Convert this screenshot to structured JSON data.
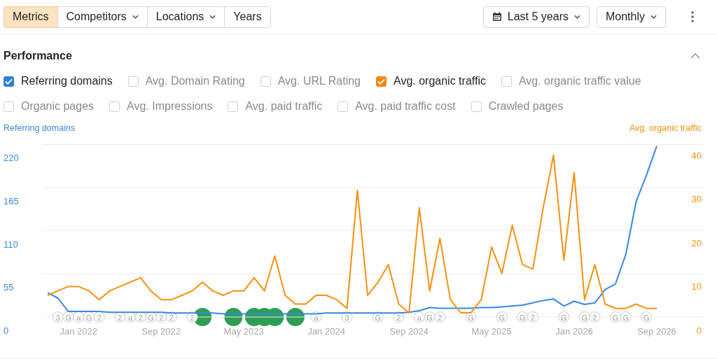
{
  "toolbar": {
    "tabs": [
      {
        "label": "Metrics",
        "selected": true,
        "dropdown": false
      },
      {
        "label": "Competitors",
        "selected": false,
        "dropdown": true
      },
      {
        "label": "Locations",
        "selected": false,
        "dropdown": true
      },
      {
        "label": "Years",
        "selected": false,
        "dropdown": false
      }
    ],
    "date_range": {
      "label": "Last 5 years"
    },
    "interval": {
      "label": "Monthly"
    }
  },
  "performance": {
    "title": "Performance",
    "expanded": true,
    "metric_rows": [
      [
        {
          "label": "Referring domains",
          "checked": true,
          "color": "#2f7fd8"
        },
        {
          "label": "Avg. Domain Rating",
          "checked": false
        },
        {
          "label": "Avg. URL Rating",
          "checked": false
        },
        {
          "label": "Avg. organic traffic",
          "checked": true,
          "color": "#f5850f"
        },
        {
          "label": "Avg. organic traffic value",
          "checked": false
        }
      ],
      [
        {
          "label": "Organic pages",
          "checked": false
        },
        {
          "label": "Avg. Impressions",
          "checked": false
        },
        {
          "label": "Avg. paid traffic",
          "checked": false
        },
        {
          "label": "Avg. paid traffic cost",
          "checked": false
        },
        {
          "label": "Crawled pages",
          "checked": false
        }
      ]
    ],
    "chart_data": {
      "type": "line",
      "categories": [
        null,
        null,
        null,
        "Jan 2022",
        null,
        null,
        null,
        null,
        null,
        null,
        null,
        "Sep 2022",
        null,
        null,
        null,
        null,
        null,
        null,
        null,
        "May 2023",
        null,
        null,
        null,
        null,
        null,
        null,
        null,
        "Jan 2024",
        null,
        null,
        null,
        null,
        null,
        null,
        null,
        "Sep 2024",
        null,
        null,
        null,
        null,
        null,
        null,
        null,
        "May 2025",
        null,
        null,
        null,
        null,
        null,
        null,
        null,
        "Jan 2026",
        null,
        null,
        null,
        null,
        null,
        null,
        null,
        "Sep 2026"
      ],
      "ylim": [
        0,
        240
      ],
      "yticks": [
        0,
        55,
        110,
        165,
        220
      ],
      "y2lim": [
        0,
        43
      ],
      "y2ticks": [
        0,
        10,
        20,
        30,
        40
      ],
      "series": [
        {
          "name": "Referring domains",
          "color": "#3a87e0",
          "values": [
            48,
            41,
            24,
            24,
            24,
            24,
            23,
            23,
            23,
            23,
            23,
            23,
            22,
            22,
            22,
            22,
            22,
            21,
            21,
            21,
            21,
            21,
            21,
            21,
            21,
            21,
            21,
            22,
            22,
            22,
            22,
            22,
            22,
            22,
            22,
            23,
            25,
            29,
            28,
            28,
            28,
            28,
            29,
            29,
            30,
            31,
            32,
            35,
            38,
            40,
            31,
            37,
            33,
            35,
            52,
            59,
            97,
            164,
            198,
            235
          ]
        },
        {
          "name": "Avg. organic traffic",
          "color": "#f7900f",
          "axis": "y2",
          "values": [
            8,
            9,
            10,
            10,
            9,
            7,
            9,
            10,
            11,
            12,
            9,
            7,
            7,
            8,
            9,
            11,
            9,
            8,
            9,
            9,
            12,
            9,
            17,
            8,
            6,
            6,
            8,
            8,
            7,
            5,
            32,
            8,
            11,
            15,
            6,
            4,
            28,
            9,
            21,
            7,
            4,
            4,
            7,
            19,
            13,
            24,
            15,
            14,
            28,
            40,
            16,
            36,
            7,
            15,
            6,
            5,
            5,
            6,
            5,
            5
          ]
        }
      ]
    },
    "markers": [
      {
        "kind": "label",
        "label": "3"
      },
      {
        "kind": "label",
        "label": "G"
      },
      {
        "kind": "label",
        "label": "a"
      },
      {
        "kind": "label",
        "label": "G"
      },
      {
        "kind": "label",
        "label": "2"
      },
      {
        "kind": "label",
        "label": "2"
      },
      {
        "kind": "label",
        "label": "a"
      },
      {
        "kind": "label",
        "label": "2"
      },
      {
        "kind": "label",
        "label": "G"
      },
      {
        "kind": "label",
        "label": "2"
      },
      {
        "kind": "label",
        "label": "2"
      },
      {
        "kind": "label",
        "label": "2"
      },
      {
        "kind": "event",
        "color": "#2e9e55"
      },
      {
        "kind": "event",
        "color": "#2e9e55"
      },
      {
        "kind": "event",
        "color": "#2e9e55"
      },
      {
        "kind": "event",
        "color": "#2e9e55"
      },
      {
        "kind": "event",
        "color": "#2e9e55"
      },
      {
        "kind": "event",
        "color": "#2e9e55"
      },
      {
        "kind": "label",
        "label": "a"
      },
      {
        "kind": "label",
        "label": "3"
      },
      {
        "kind": "label",
        "label": "G"
      },
      {
        "kind": "label",
        "label": "2"
      },
      {
        "kind": "label",
        "label": "a"
      },
      {
        "kind": "label",
        "label": "G"
      },
      {
        "kind": "label",
        "label": "2"
      },
      {
        "kind": "label",
        "label": "G"
      },
      {
        "kind": "label",
        "label": "G"
      },
      {
        "kind": "label",
        "label": "G"
      },
      {
        "kind": "label",
        "label": "2"
      },
      {
        "kind": "label",
        "label": "G"
      },
      {
        "kind": "label",
        "label": "G"
      },
      {
        "kind": "label",
        "label": "2"
      },
      {
        "kind": "label",
        "label": "G"
      },
      {
        "kind": "label",
        "label": "G"
      },
      {
        "kind": "label",
        "label": "G"
      }
    ]
  }
}
